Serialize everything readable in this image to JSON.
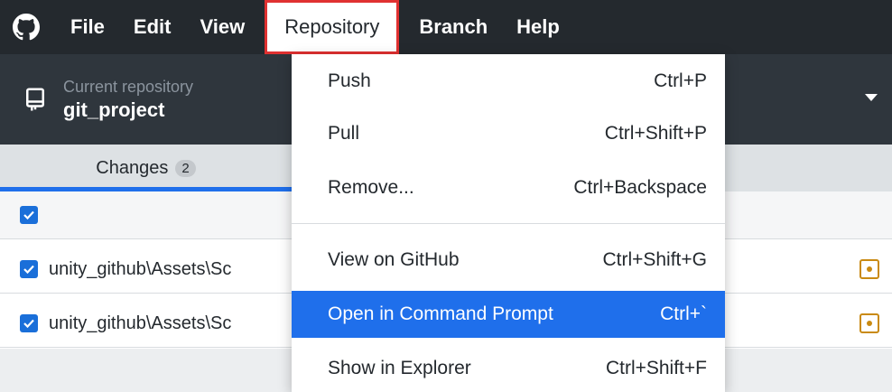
{
  "menubar": {
    "items": [
      "File",
      "Edit",
      "View",
      "Repository",
      "Branch",
      "Help"
    ]
  },
  "toolbar": {
    "repo_caption": "Current repository",
    "repo_name": "git_project"
  },
  "tabs": {
    "changes_label": "Changes",
    "changes_count": "2"
  },
  "files": [
    {
      "path": "unity_github\\Assets\\Sc"
    },
    {
      "path": "unity_github\\Assets\\Sc"
    }
  ],
  "repository_menu": {
    "items": [
      {
        "label": "Push",
        "shortcut": "Ctrl+P"
      },
      {
        "label": "Pull",
        "shortcut": "Ctrl+Shift+P"
      },
      {
        "label": "Remove...",
        "shortcut": "Ctrl+Backspace"
      },
      {
        "label": "View on GitHub",
        "shortcut": "Ctrl+Shift+G"
      },
      {
        "label": "Open in Command Prompt",
        "shortcut": "Ctrl+`"
      },
      {
        "label": "Show in Explorer",
        "shortcut": "Ctrl+Shift+F"
      }
    ],
    "selected_label": "Open in Command Prompt"
  },
  "colors": {
    "menubar_bg": "#24292e",
    "accent": "#1f6feb",
    "highlight_box": "#e03131",
    "modified": "#c98a12"
  }
}
